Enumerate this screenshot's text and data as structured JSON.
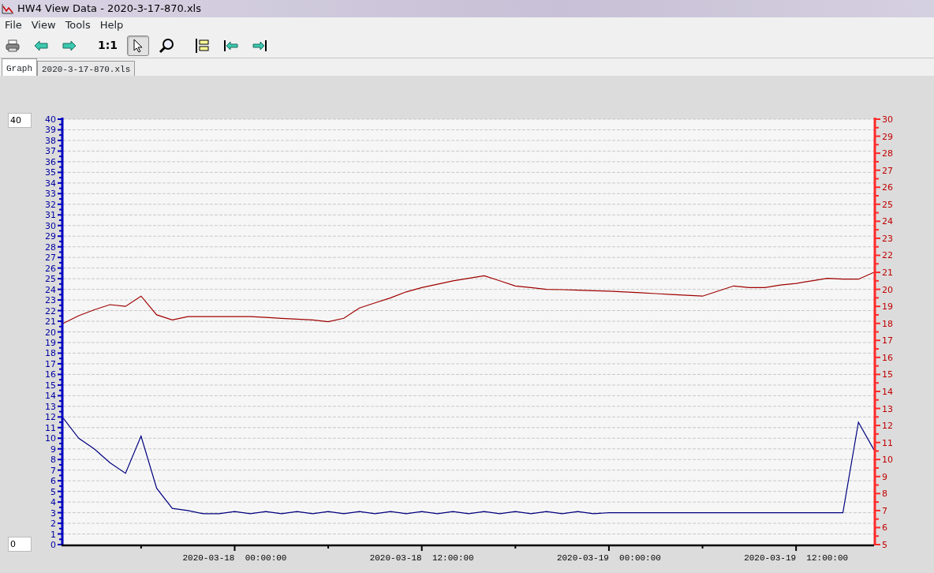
{
  "window": {
    "title": "HW4 View Data - 2020-3-17-870.xls"
  },
  "menu": [
    "File",
    "View",
    "Tools",
    "Help"
  ],
  "toolbar": [
    {
      "kind": "print",
      "selected": false
    },
    {
      "kind": "back",
      "selected": false
    },
    {
      "kind": "forward",
      "selected": false
    },
    {
      "kind": "text",
      "label": "1:1",
      "selected": false
    },
    {
      "kind": "pointer",
      "selected": true
    },
    {
      "kind": "zoom",
      "selected": false
    },
    {
      "kind": "bars",
      "selected": false
    },
    {
      "kind": "first",
      "selected": false
    },
    {
      "kind": "last",
      "selected": false
    }
  ],
  "tabs": [
    {
      "label": "Graph",
      "selected": true
    },
    {
      "label": "2020-3-17-870.xls",
      "selected": false
    }
  ],
  "range_fields": {
    "max_value": "40",
    "min_value": "0"
  },
  "graph": {
    "chart_data": {
      "type": "line",
      "categories": [
        null,
        null,
        null,
        null,
        null,
        null,
        null,
        null,
        null,
        null,
        null,
        "2020-03-18  00:00:00",
        null,
        null,
        null,
        null,
        null,
        null,
        null,
        null,
        null,
        null,
        null,
        "2020-03-18  12:00:00",
        null,
        null,
        null,
        null,
        null,
        null,
        null,
        null,
        null,
        null,
        null,
        "2020-03-19  00:00:00",
        null,
        null,
        null,
        null,
        null,
        null,
        null,
        null,
        null,
        null,
        null,
        "2020-03-19  12:00:00",
        null,
        null,
        null,
        null,
        null
      ],
      "series": [
        {
          "color": "#000080",
          "values": [
            11.9,
            10.0,
            9.0,
            7.7,
            6.7,
            10.2,
            5.3,
            3.4,
            3.2,
            2.9,
            2.9,
            3.1,
            2.9,
            3.1,
            2.9,
            3.1,
            2.9,
            3.1,
            2.9,
            3.1,
            2.9,
            3.1,
            2.9,
            3.1,
            2.9,
            3.1,
            2.9,
            3.1,
            2.9,
            3.1,
            2.9,
            3.1,
            2.9,
            3.1,
            2.9,
            3.0,
            3.0,
            3.0,
            3.0,
            3.0,
            3.0,
            3.0,
            3.0,
            3.0,
            3.0,
            3.0,
            3.0,
            3.0,
            3.0,
            3.0,
            3.0,
            11.5,
            8.9
          ]
        },
        {
          "color": "#a00000",
          "axis": "y2",
          "values": [
            18.0,
            18.45,
            18.8,
            19.1,
            19.0,
            19.6,
            18.5,
            18.2,
            18.4,
            18.4,
            18.4,
            18.4,
            18.4,
            18.35,
            18.3,
            18.25,
            18.2,
            18.1,
            18.3,
            18.9,
            19.2,
            19.5,
            19.85,
            20.1,
            20.3,
            20.5,
            20.65,
            20.8,
            20.5,
            20.2,
            20.1,
            20.0,
            19.98,
            19.95,
            19.92,
            19.9,
            19.85,
            19.8,
            19.75,
            19.7,
            19.65,
            19.6,
            19.9,
            20.2,
            20.1,
            20.1,
            20.25,
            20.35,
            20.5,
            20.65,
            20.6,
            20.6,
            21.0
          ]
        }
      ],
      "grid": true,
      "ylim": [
        0,
        40
      ],
      "y2lim": [
        5,
        30
      ],
      "yticks": [
        0,
        1,
        2,
        3,
        4,
        5,
        6,
        7,
        8,
        9,
        10,
        11,
        12,
        13,
        14,
        15,
        16,
        17,
        18,
        19,
        20,
        21,
        22,
        23,
        24,
        25,
        26,
        27,
        28,
        29,
        30,
        31,
        32,
        33,
        34,
        35,
        36,
        37,
        38,
        39,
        40
      ],
      "y2ticks": [
        5,
        6,
        7,
        8,
        9,
        10,
        11,
        12,
        13,
        14,
        15,
        16,
        17,
        18,
        19,
        20,
        21,
        22,
        23,
        24,
        25,
        26,
        27,
        28,
        29,
        30
      ]
    }
  }
}
